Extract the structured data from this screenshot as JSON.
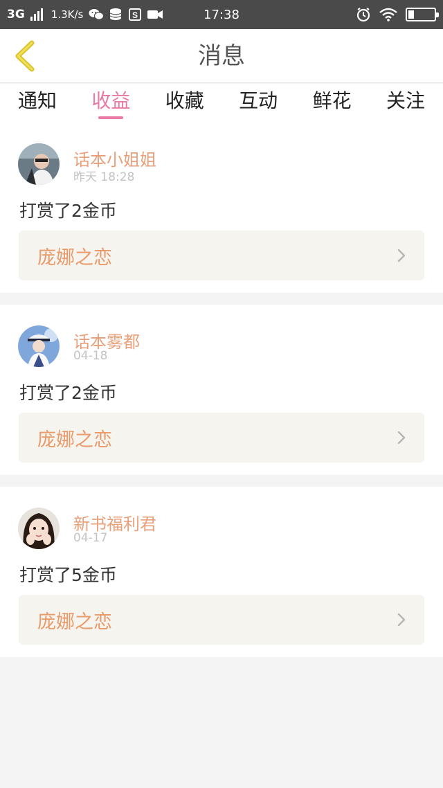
{
  "status_bar": {
    "network": "3G",
    "speed": "1.3K/s",
    "time": "17:38",
    "icons": [
      "signal-icon",
      "wechat-icon",
      "database-icon",
      "s-app-icon",
      "video-icon",
      "alarm-icon",
      "wifi-icon",
      "battery-icon"
    ]
  },
  "header": {
    "title": "消息",
    "back_icon": "back-chevron-icon",
    "accent": "#e0c92b"
  },
  "tabs": [
    {
      "label": "通知",
      "active": false
    },
    {
      "label": "收益",
      "active": true
    },
    {
      "label": "收藏",
      "active": false
    },
    {
      "label": "互动",
      "active": false
    },
    {
      "label": "鲜花",
      "active": false
    },
    {
      "label": "关注",
      "active": false
    }
  ],
  "colors": {
    "active_tab": "#e87aa3",
    "username": "#e8a07a",
    "book_title": "#e89a6a",
    "book_bg": "#f5f4ee"
  },
  "messages": [
    {
      "user": "话本小姐姐",
      "time": "昨天  18:28",
      "text": "打赏了2金币",
      "book": "庞娜之恋"
    },
    {
      "user": "话本雾都",
      "time": "04-18",
      "text": "打赏了2金币",
      "book": "庞娜之恋"
    },
    {
      "user": "新书福利君",
      "time": "04-17",
      "text": "打赏了5金币",
      "book": "庞娜之恋"
    }
  ]
}
